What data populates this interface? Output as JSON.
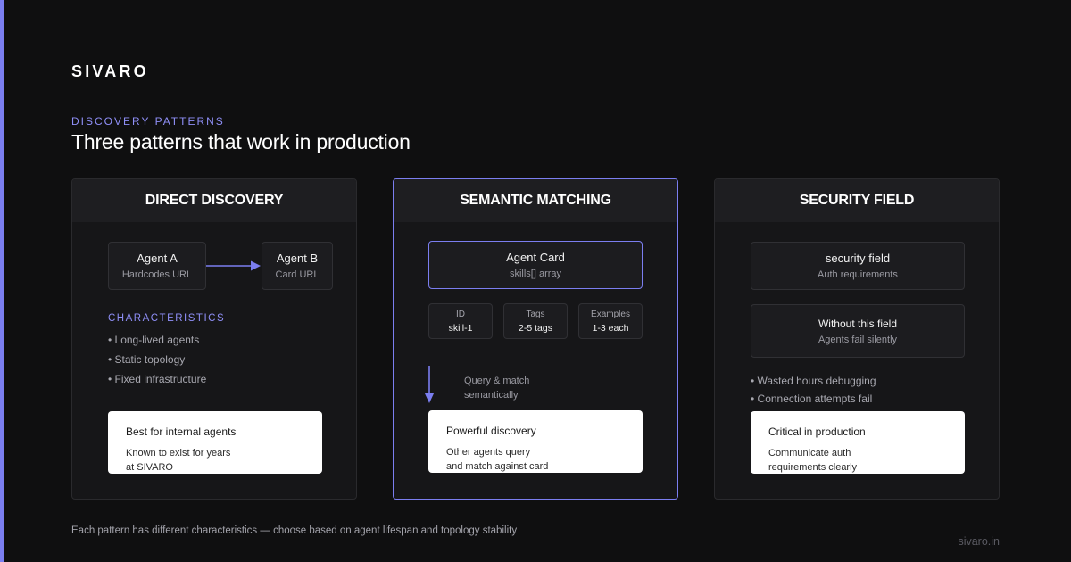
{
  "brand": "SIVARO",
  "kicker": "DISCOVERY PATTERNS",
  "headline": "Three patterns that work in production",
  "colors": {
    "accent": "#7b7ef0",
    "background": "#0f0f10",
    "panel": "#161618"
  },
  "panels": [
    {
      "title": "DIRECT DISCOVERY",
      "agent_a": {
        "title": "Agent A",
        "sub": "Hardcodes URL"
      },
      "agent_b": {
        "title": "Agent B",
        "sub": "Card URL"
      },
      "characteristics_label": "CHARACTERISTICS",
      "bullets": [
        "• Long-lived agents",
        "• Static topology",
        "• Fixed infrastructure"
      ],
      "callout": {
        "title": "Best for internal agents",
        "line1": "Known to exist for years",
        "line2": "at SIVARO"
      }
    },
    {
      "title": "SEMANTIC MATCHING",
      "card": {
        "title": "Agent Card",
        "sub": "skills[] array"
      },
      "fields": [
        {
          "label": "ID",
          "value": "skill-1"
        },
        {
          "label": "Tags",
          "value": "2-5 tags"
        },
        {
          "label": "Examples",
          "value": "1-3 each"
        }
      ],
      "arrow_note": {
        "line1": "Query & match",
        "line2": "semantically"
      },
      "callout": {
        "title": "Powerful discovery",
        "line1": "Other agents query",
        "line2": "and match against card"
      }
    },
    {
      "title": "SECURITY FIELD",
      "field_box": {
        "title": "security field",
        "sub": "Auth requirements"
      },
      "without_box": {
        "title": "Without this field",
        "sub": "Agents fail silently"
      },
      "bullets": [
        "• Wasted hours debugging",
        "• Connection attempts fail"
      ],
      "callout": {
        "title": "Critical in production",
        "line1": "Communicate auth",
        "line2": "requirements clearly"
      }
    }
  ],
  "footer": {
    "note": "Each pattern has different characteristics — choose based on agent lifespan and topology stability",
    "url": "sivaro.in"
  }
}
